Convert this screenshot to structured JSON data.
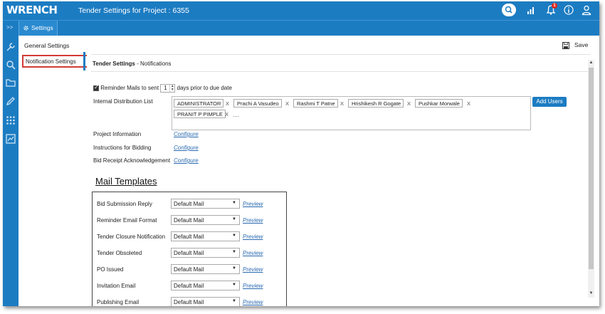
{
  "app": {
    "logo": "WRENCH",
    "title": "Tender Settings for Project : 6355",
    "notification_count": "1",
    "brand_color": "#1c7cc2"
  },
  "topbar": {
    "icons": [
      "search-icon",
      "bar-chart-icon",
      "bell-icon",
      "info-icon",
      "user-icon"
    ]
  },
  "subbar": {
    "expand_label": ">>",
    "tab_label": "Settings"
  },
  "sidebar": {
    "icons": [
      "wrench-icon",
      "search-icon",
      "folder-icon",
      "pencil-icon",
      "grid-icon",
      "report-icon"
    ]
  },
  "left_nav": {
    "general_label": "General Settings",
    "notification_label": "Notification Settings"
  },
  "header": {
    "save_label": "Save",
    "crumb_main": "Tender Settings",
    "crumb_sub": "- Notifications"
  },
  "reminder": {
    "label_before": "Reminder Mails to sent",
    "days_value": "1",
    "label_after": "days prior to due date",
    "checked": true
  },
  "distribution": {
    "label": "Internal Distribution List",
    "users": [
      "ADMINISTRATOR",
      "Prachi A Vasudeo",
      "Rashmi T Patne",
      "Hrishikesh R Gogate",
      "Pushkar Morwale",
      "PRANIT P PIMPLE"
    ],
    "remove_glyph": "X",
    "more": "....",
    "add_users_label": "Add Users"
  },
  "settings": [
    {
      "label": "Project Information",
      "link": "Configure"
    },
    {
      "label": "Instructions for Bidding",
      "link": "Configure"
    },
    {
      "label": "Bid Receipt Acknowledgement",
      "link": "Configure"
    }
  ],
  "mail_templates": {
    "title": "Mail Templates",
    "preview_label": "Preview",
    "rows": [
      {
        "label": "Bid Submission Reply",
        "value": "Default Mail"
      },
      {
        "label": "Reminder Email Format",
        "value": "Default Mail"
      },
      {
        "label": "Tender Closure Notification",
        "value": "Default Mail"
      },
      {
        "label": "Tender Obsoleted",
        "value": "Default Mail"
      },
      {
        "label": "PO Issued",
        "value": "Default Mail"
      },
      {
        "label": "Invitation Email",
        "value": "Default Mail"
      },
      {
        "label": "Publishing Email",
        "value": "Default Mail"
      }
    ]
  }
}
